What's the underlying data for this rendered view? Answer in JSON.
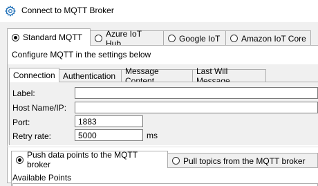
{
  "window": {
    "title": "Connect to MQTT Broker"
  },
  "providers": [
    {
      "label": "Standard MQTT",
      "selected": true
    },
    {
      "label": "Azure IoT Hub",
      "selected": false
    },
    {
      "label": "Google IoT",
      "selected": false
    },
    {
      "label": "Amazon IoT Core",
      "selected": false
    }
  ],
  "instructions": "Configure MQTT in the settings below",
  "settings_tabs": [
    {
      "label": "Connection",
      "active": true
    },
    {
      "label": "Authentication",
      "active": false
    },
    {
      "label": "Message Content",
      "active": false
    },
    {
      "label": "Last Will Message",
      "active": false
    }
  ],
  "connection": {
    "label_field": {
      "label": "Label:",
      "value": ""
    },
    "host_field": {
      "label": "Host Name/IP:",
      "value": ""
    },
    "port_field": {
      "label": "Port:",
      "value": "1883"
    },
    "retry_field": {
      "label": "Retry rate:",
      "value": "5000",
      "unit": "ms"
    }
  },
  "direction_tabs": [
    {
      "label": "Push data points to the MQTT broker",
      "selected": true
    },
    {
      "label": "Pull topics from the MQTT broker",
      "selected": false
    }
  ],
  "available_points": {
    "label": "Available Points"
  },
  "colors": {
    "accent_icon": "#1e6fb8",
    "panel_bg": "#f0f0f0",
    "border": "#adadad"
  },
  "icons": {
    "app": "gear-icon"
  }
}
